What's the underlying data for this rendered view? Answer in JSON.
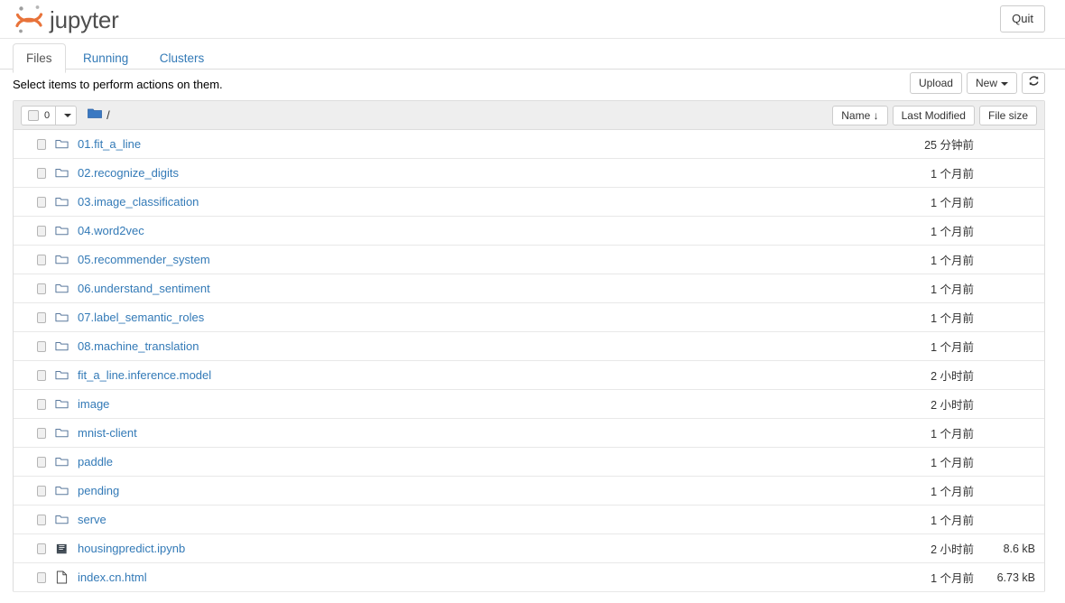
{
  "header": {
    "brand": "jupyter",
    "logo_icon": "jupyter-logo",
    "quit_label": "Quit"
  },
  "tabs": [
    {
      "label": "Files",
      "active": true
    },
    {
      "label": "Running",
      "active": false
    },
    {
      "label": "Clusters",
      "active": false
    }
  ],
  "actionbar": {
    "hint": "Select items to perform actions on them.",
    "upload_label": "Upload",
    "new_label": "New",
    "refresh_icon": "refresh-icon"
  },
  "list_header": {
    "select_count": "0",
    "breadcrumb_icon": "folder-filled-icon",
    "breadcrumb_path": "/",
    "sort_name": "Name",
    "sort_name_arrow": "↓",
    "sort_modified": "Last Modified",
    "sort_size": "File size"
  },
  "files": [
    {
      "name": "01.fit_a_line",
      "icon": "folder-icon",
      "modified": "25 分钟前",
      "size": ""
    },
    {
      "name": "02.recognize_digits",
      "icon": "folder-icon",
      "modified": "1 个月前",
      "size": ""
    },
    {
      "name": "03.image_classification",
      "icon": "folder-icon",
      "modified": "1 个月前",
      "size": ""
    },
    {
      "name": "04.word2vec",
      "icon": "folder-icon",
      "modified": "1 个月前",
      "size": ""
    },
    {
      "name": "05.recommender_system",
      "icon": "folder-icon",
      "modified": "1 个月前",
      "size": ""
    },
    {
      "name": "06.understand_sentiment",
      "icon": "folder-icon",
      "modified": "1 个月前",
      "size": ""
    },
    {
      "name": "07.label_semantic_roles",
      "icon": "folder-icon",
      "modified": "1 个月前",
      "size": ""
    },
    {
      "name": "08.machine_translation",
      "icon": "folder-icon",
      "modified": "1 个月前",
      "size": ""
    },
    {
      "name": "fit_a_line.inference.model",
      "icon": "folder-icon",
      "modified": "2 小时前",
      "size": ""
    },
    {
      "name": "image",
      "icon": "folder-icon",
      "modified": "2 小时前",
      "size": ""
    },
    {
      "name": "mnist-client",
      "icon": "folder-icon",
      "modified": "1 个月前",
      "size": ""
    },
    {
      "name": "paddle",
      "icon": "folder-icon",
      "modified": "1 个月前",
      "size": ""
    },
    {
      "name": "pending",
      "icon": "folder-icon",
      "modified": "1 个月前",
      "size": ""
    },
    {
      "name": "serve",
      "icon": "folder-icon",
      "modified": "1 个月前",
      "size": ""
    },
    {
      "name": "housingpredict.ipynb",
      "icon": "notebook-icon",
      "modified": "2 小时前",
      "size": "8.6 kB"
    },
    {
      "name": "index.cn.html",
      "icon": "file-icon",
      "modified": "1 个月前",
      "size": "6.73 kB"
    }
  ],
  "colors": {
    "link": "#337ab7",
    "logo_orange": "#e8733a",
    "folder_outline": "#5b7a9e",
    "header_bg": "#eeeeee"
  }
}
